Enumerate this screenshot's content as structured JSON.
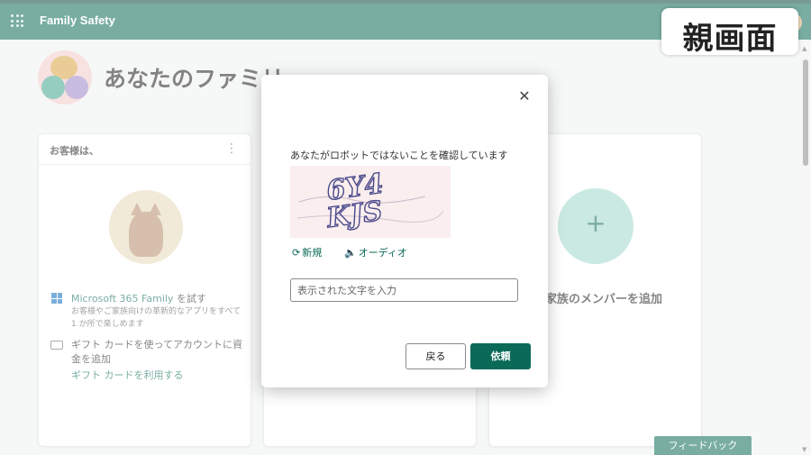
{
  "app": {
    "title": "Family Safety"
  },
  "page": {
    "family_heading": "あなたのファミリー",
    "card1": {
      "header": "お客様は、",
      "ms_title_link": "Microsoft 365 Family",
      "ms_title_suffix": " を試す",
      "ms_desc": "お客様やご家族向けの革新的なアプリをすべて 1 か所で楽しめます",
      "gift_text": "ギフト カードを使ってアカウントに資金を追加",
      "gift_link": "ギフト カードを利用する"
    },
    "card3": {
      "add_member": "家族のメンバーを追加"
    },
    "feedback_label": "フィードバック"
  },
  "watermark": {
    "label": "親画面"
  },
  "dialog": {
    "message": "あなたがロボットではないことを確認しています",
    "captcha_text": "6Y4KJS",
    "new_label": "新規",
    "audio_label": "オーディオ",
    "input_placeholder": "表示された文字を入力",
    "input_value": "",
    "back_label": "戻る",
    "request_label": "依頼"
  },
  "colors": {
    "brand": "#0b6a57",
    "topbar_dark": "#08493c",
    "captcha_bg": "#fbeeee",
    "plus_circle": "#9ed7ca"
  },
  "icons": {
    "waffle": "waffle-icon",
    "close": "close-icon",
    "refresh": "refresh-icon",
    "audio": "speaker-icon",
    "microsoft": "microsoft-logo-icon",
    "gift": "gift-card-icon",
    "plus": "plus-icon",
    "kebab": "more-options-icon"
  }
}
